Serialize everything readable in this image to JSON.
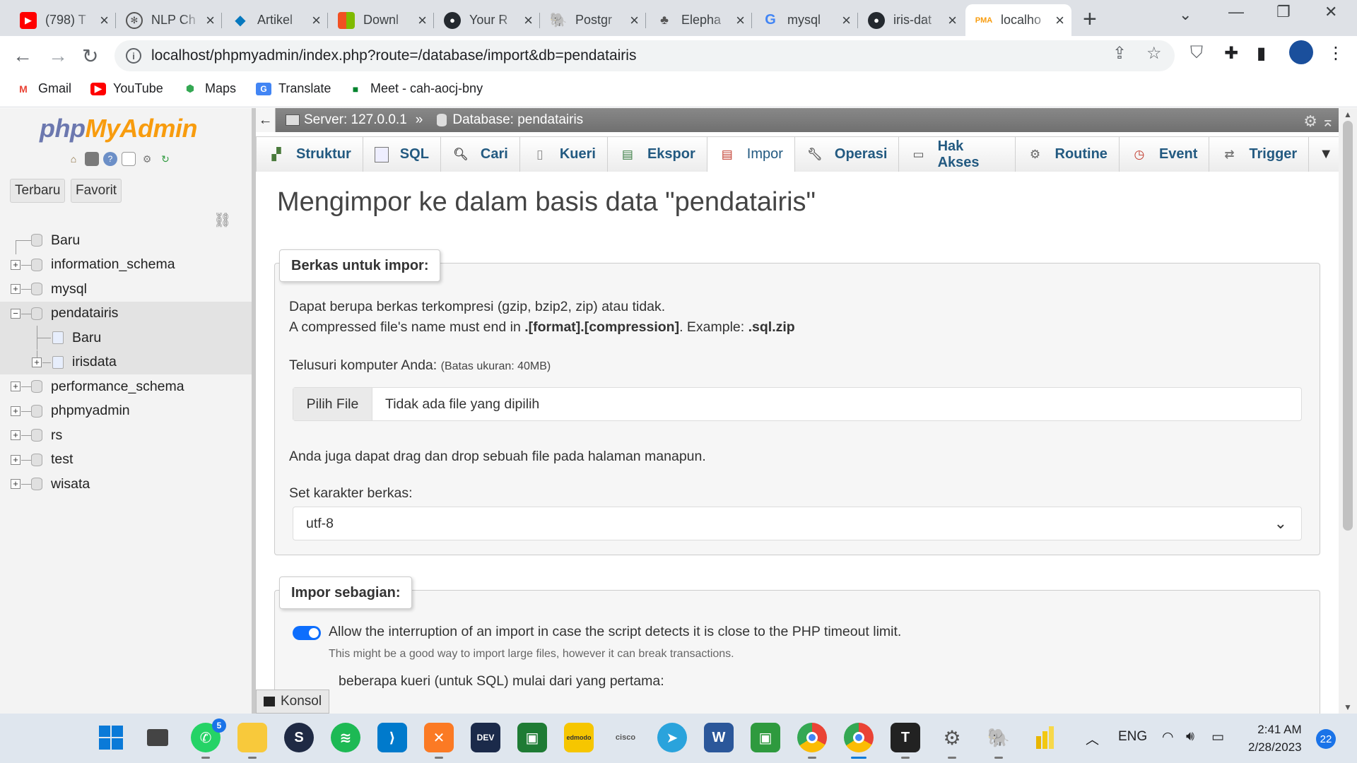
{
  "browser": {
    "tabs": [
      {
        "title": "(798) T",
        "icon": "youtube-icon",
        "color": "#ff0000"
      },
      {
        "title": "NLP Ch",
        "icon": "chatgpt-icon",
        "color": "#10a37f"
      },
      {
        "title": "Artikel",
        "icon": "drupal-icon",
        "color": "#0678be"
      },
      {
        "title": "Downl",
        "icon": "microsoft-icon",
        "color": "#f25022"
      },
      {
        "title": "Your R",
        "icon": "github-icon",
        "color": "#24292f"
      },
      {
        "title": "Postgr",
        "icon": "postgres-icon",
        "color": "#336791"
      },
      {
        "title": "Elepha",
        "icon": "elephant-icon",
        "color": "#555555"
      },
      {
        "title": "mysql",
        "icon": "google-icon",
        "color": "#4285f4"
      },
      {
        "title": "iris-dat",
        "icon": "github-icon",
        "color": "#24292f"
      },
      {
        "title": "localho",
        "icon": "phpmyadmin-icon",
        "color": "#f89c0e"
      }
    ],
    "url": "localhost/phpmyadmin/index.php?route=/database/import&db=pendatairis",
    "bookmarks": [
      {
        "label": "Gmail",
        "icon": "gmail-icon"
      },
      {
        "label": "YouTube",
        "icon": "youtube-icon"
      },
      {
        "label": "Maps",
        "icon": "maps-icon"
      },
      {
        "label": "Translate",
        "icon": "translate-icon"
      },
      {
        "label": "Meet - cah-aocj-bny",
        "icon": "meet-icon"
      }
    ]
  },
  "pma": {
    "logo_a": "php",
    "logo_b": "MyAdmin",
    "recent_label": "Terbaru",
    "favorites_label": "Favorit",
    "tree": {
      "new": "Baru",
      "dbs": [
        "information_schema",
        "mysql",
        "pendatairis",
        "performance_schema",
        "phpmyadmin",
        "rs",
        "test",
        "wisata"
      ],
      "pendatairis_children": [
        "Baru",
        "irisdata"
      ]
    },
    "breadcrumb": {
      "server": "Server: 127.0.0.1",
      "sep": "»",
      "database": "Database: pendatairis"
    },
    "tabs": [
      "Struktur",
      "SQL",
      "Cari",
      "Kueri",
      "Ekspor",
      "Impor",
      "Operasi",
      "Hak Akses",
      "Routine",
      "Event",
      "Trigger"
    ],
    "active_tab": "Impor",
    "page_title": "Mengimpor ke dalam basis data \"pendatairis\"",
    "file_section": {
      "legend": "Berkas untuk impor:",
      "line1": "Dapat berupa berkas terkompresi (gzip, bzip2, zip) atau tidak.",
      "line2_a": "A compressed file's name must end in ",
      "line2_b": ".[format].[compression]",
      "line2_c": ". Example: ",
      "line2_d": ".sql.zip",
      "browse_label": "Telusuri komputer Anda:",
      "size_limit": "(Batas ukuran: 40MB)",
      "choose_button": "Pilih File",
      "no_file": "Tidak ada file yang dipilih",
      "drag_text": "Anda juga dapat drag dan drop sebuah file pada halaman manapun.",
      "charset_label": "Set karakter berkas:",
      "charset_value": "utf-8"
    },
    "partial_section": {
      "legend": "Impor sebagian:",
      "allow_interrupt": "Allow the interruption of an import in case the script detects it is close to the PHP timeout limit.",
      "allow_interrupt_checked": true,
      "hint": "This might be a good way to import large files, however it can break transactions.",
      "skip_text": "beberapa kueri (untuk SQL) mulai dari yang pertama:"
    },
    "console_label": "Konsol"
  },
  "taskbar": {
    "whatsapp_badge": "5",
    "lang": "ENG",
    "time": "2:41 AM",
    "date": "2/28/2023",
    "notifications": "22"
  }
}
